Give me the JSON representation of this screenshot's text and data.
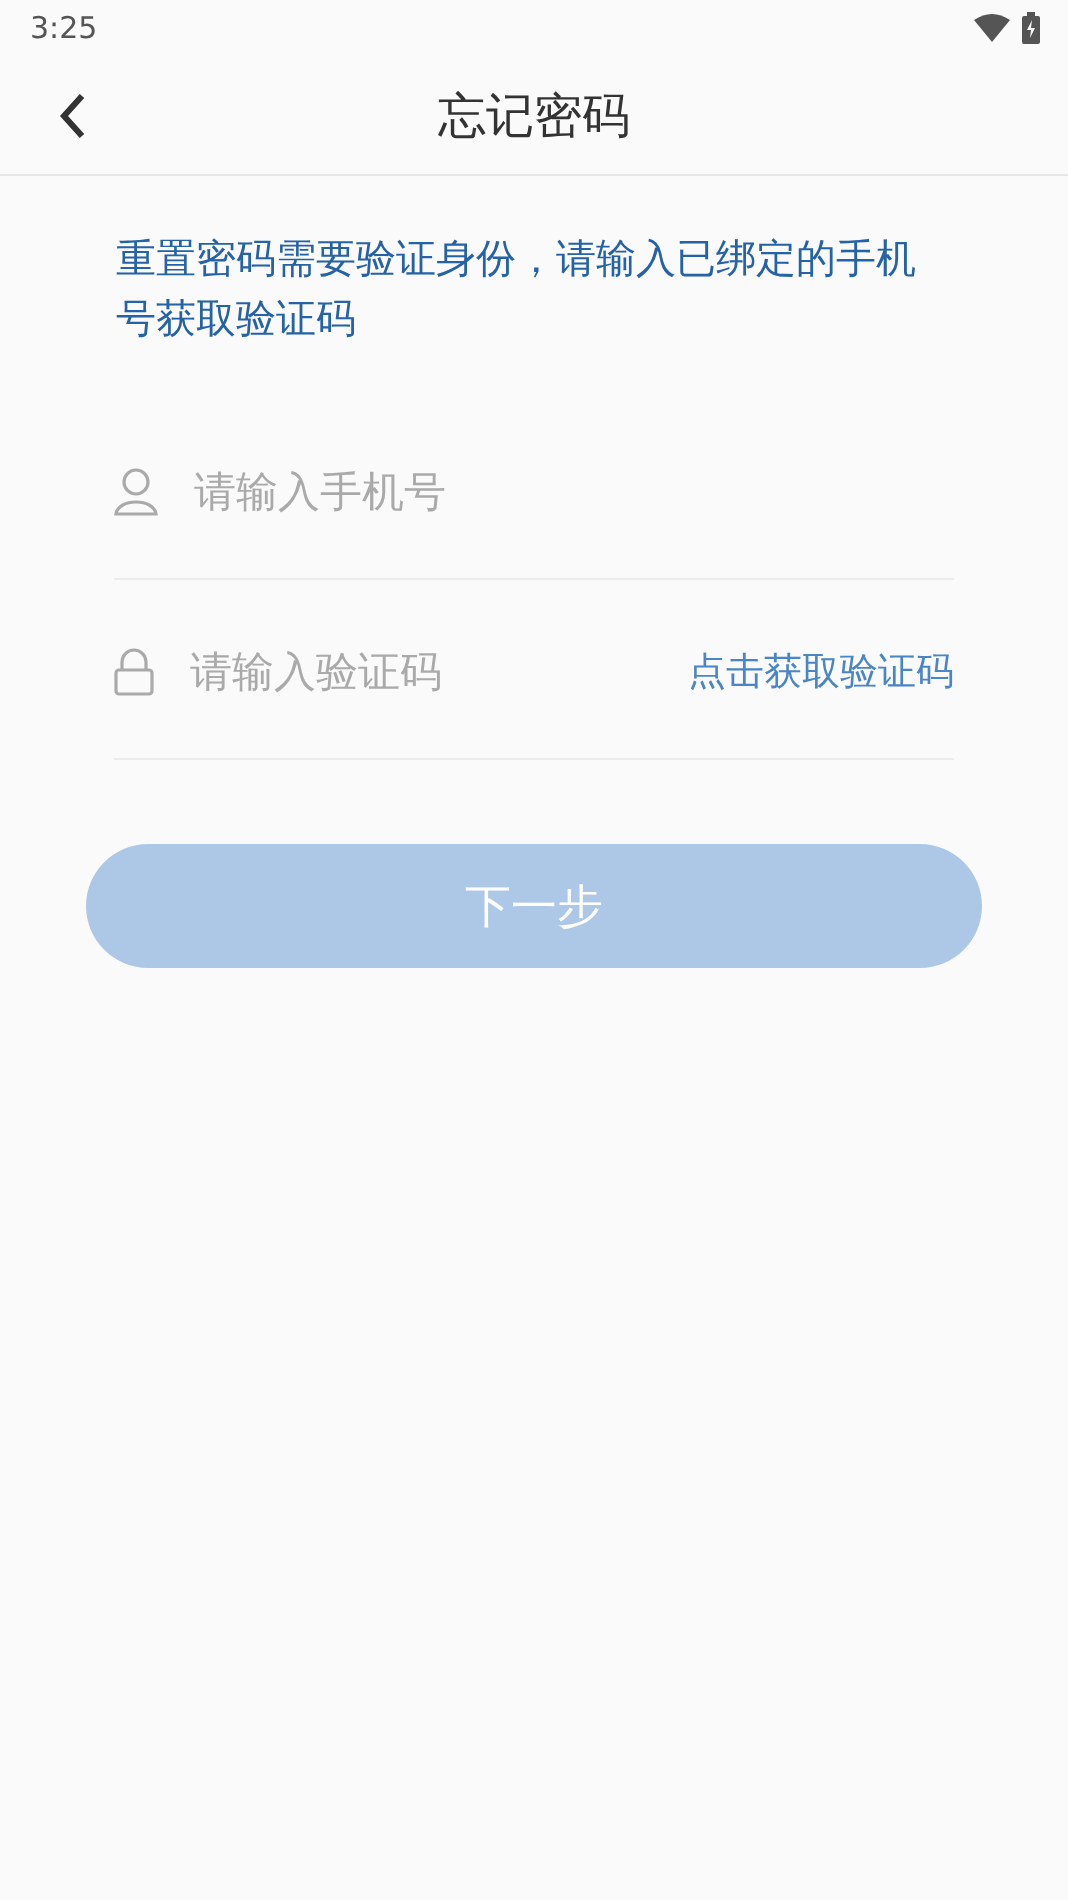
{
  "status_bar": {
    "time": "3:25"
  },
  "header": {
    "title": "忘记密码"
  },
  "intro": "重置密码需要验证身份，请输入已绑定的手机号获取验证码",
  "fields": [
    {
      "kind": "phone",
      "placeholder": "请输入手机号"
    },
    {
      "kind": "code",
      "placeholder": "请输入验证码",
      "action": "点击获取验证码"
    }
  ],
  "next_button": {
    "label": "下一步",
    "disabled": true
  }
}
